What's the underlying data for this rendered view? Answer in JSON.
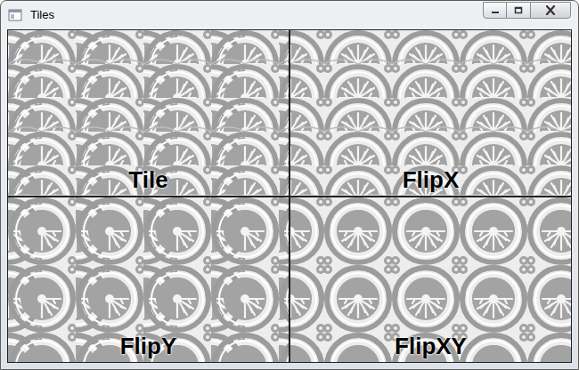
{
  "window": {
    "title": "Tiles"
  },
  "quadrants": [
    {
      "label": "Tile",
      "kind": "tile"
    },
    {
      "label": "FlipX",
      "kind": "flipx"
    },
    {
      "label": "FlipY",
      "kind": "flipy"
    },
    {
      "label": "FlipXY",
      "kind": "flipxy"
    }
  ]
}
